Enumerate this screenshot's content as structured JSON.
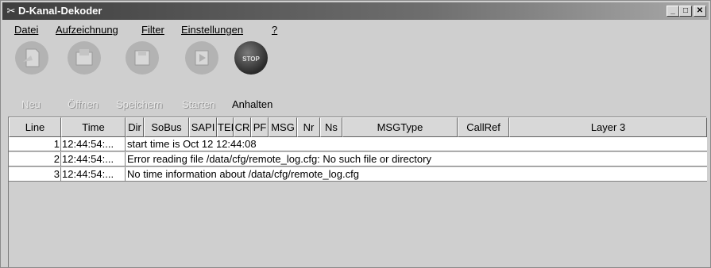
{
  "window": {
    "title": "D-Kanal-Dekoder",
    "controls": {
      "minimize": "_",
      "maximize": "□",
      "close": "✕"
    }
  },
  "menu": [
    "Datei",
    "Aufzeichnung",
    "Filter",
    "Einstellungen",
    "?"
  ],
  "toolbar": {
    "buttons": [
      {
        "label": "Neu",
        "icon": "new-file-icon",
        "enabled": false
      },
      {
        "label": "Öffnen",
        "icon": "open-folder-icon",
        "enabled": false
      },
      {
        "label": "Speichern",
        "icon": "save-disk-icon",
        "enabled": false
      },
      {
        "label": "Starten",
        "icon": "start-record-icon",
        "enabled": false
      },
      {
        "label": "Anhalten",
        "icon": "stop-sign-icon",
        "enabled": true,
        "icon_text": "STOP"
      }
    ]
  },
  "table": {
    "columns": [
      "Line",
      "Time",
      "Dir",
      "SoBus",
      "SAPI",
      "TEI",
      "CR",
      "PF",
      "MSG",
      "Nr",
      "Ns",
      "MSGType",
      "CallRef",
      "Layer 3"
    ],
    "rows": [
      {
        "line": "1",
        "time": "12:44:54:...",
        "message": "start time is Oct 12 12:44:08"
      },
      {
        "line": "2",
        "time": "12:44:54:...",
        "message": "Error reading file /data/cfg/remote_log.cfg: No such file or directory"
      },
      {
        "line": "3",
        "time": "12:44:54:...",
        "message": "No time information about /data/cfg/remote_log.cfg"
      }
    ]
  }
}
